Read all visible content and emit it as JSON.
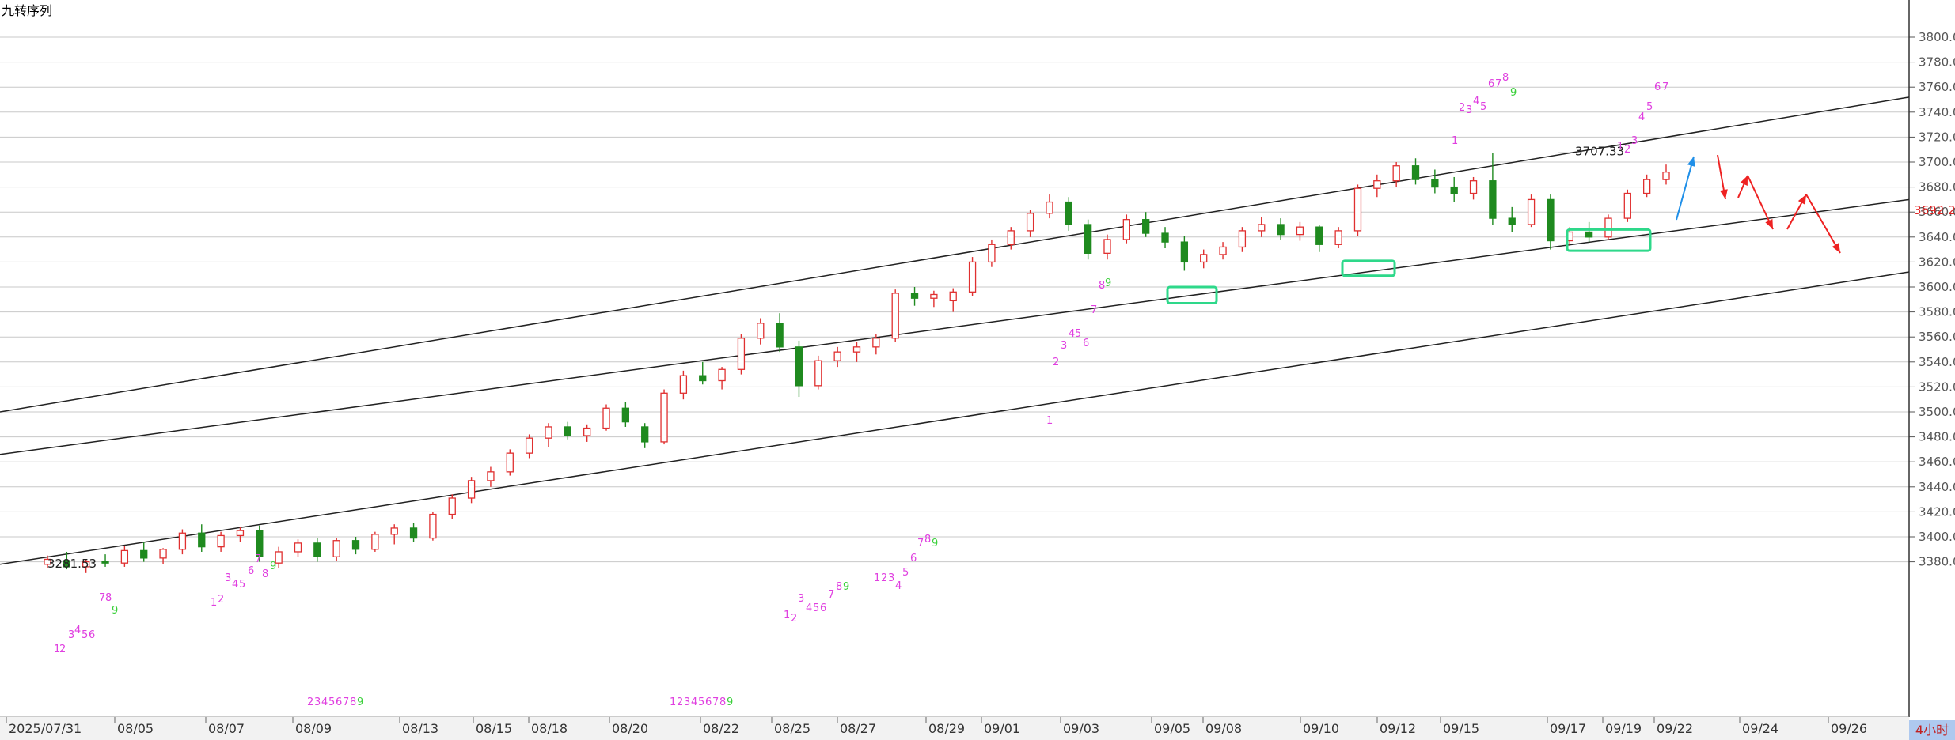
{
  "title": "九转序列",
  "interval": "4小时",
  "current_price": "3692.25",
  "colors": {
    "up": "#e03030",
    "down": "#1f8a1f",
    "sequence": "#e040e0",
    "sequence_complete": "#3ad03a",
    "highlight_box": "#2ed88a",
    "arrow_up": "#1f8fe8",
    "arrow_down": "#ee2222"
  },
  "chart_data": {
    "type": "candlestick",
    "title": "九转序列",
    "xlabel": "",
    "ylabel": "",
    "ylim": [
      3370,
      3810
    ],
    "grid": true,
    "y_ticks": [
      3380,
      3400,
      3420,
      3440,
      3460,
      3480,
      3500,
      3520,
      3540,
      3560,
      3580,
      3600,
      3620,
      3640,
      3660,
      3680,
      3700,
      3720,
      3740,
      3760,
      3780,
      3800
    ],
    "x_ticks": [
      "2025/07/31",
      "08/05",
      "08/07",
      "08/09",
      "08/13",
      "08/15",
      "08/18",
      "08/20",
      "08/22",
      "08/25",
      "08/27",
      "08/29",
      "09/01",
      "09/03",
      "09/05",
      "09/08",
      "09/10",
      "09/12",
      "09/15",
      "09/17",
      "09/19",
      "09/22",
      "09/24",
      "09/26"
    ],
    "annotations": [
      {
        "text": "3281.53",
        "x": "07/31",
        "y": 3378
      },
      {
        "text": "3707.33",
        "x": "09/17",
        "y": 3707.33
      }
    ],
    "ohlc": [
      [
        3378,
        3385,
        3375,
        3382
      ],
      [
        3381,
        3388,
        3374,
        3376
      ],
      [
        3376,
        3382,
        3371,
        3380
      ],
      [
        3380,
        3386,
        3376,
        3379
      ],
      [
        3379,
        3393,
        3376,
        3389
      ],
      [
        3389,
        3396,
        3380,
        3383
      ],
      [
        3383,
        3391,
        3378,
        3390
      ],
      [
        3390,
        3406,
        3386,
        3403
      ],
      [
        3403,
        3410,
        3388,
        3392
      ],
      [
        3392,
        3404,
        3388,
        3401
      ],
      [
        3401,
        3408,
        3396,
        3405
      ],
      [
        3405,
        3409,
        3380,
        3384
      ],
      [
        3379,
        3392,
        3375,
        3388
      ],
      [
        3388,
        3398,
        3384,
        3395
      ],
      [
        3395,
        3399,
        3380,
        3384
      ],
      [
        3384,
        3399,
        3381,
        3397
      ],
      [
        3397,
        3400,
        3386,
        3390
      ],
      [
        3390,
        3404,
        3388,
        3402
      ],
      [
        3402,
        3410,
        3394,
        3407
      ],
      [
        3407,
        3411,
        3396,
        3399
      ],
      [
        3399,
        3420,
        3397,
        3418
      ],
      [
        3418,
        3434,
        3414,
        3431
      ],
      [
        3431,
        3448,
        3427,
        3445
      ],
      [
        3445,
        3456,
        3440,
        3452
      ],
      [
        3452,
        3470,
        3449,
        3467
      ],
      [
        3467,
        3482,
        3463,
        3479
      ],
      [
        3479,
        3491,
        3472,
        3488
      ],
      [
        3488,
        3492,
        3478,
        3481
      ],
      [
        3481,
        3490,
        3476,
        3487
      ],
      [
        3487,
        3506,
        3485,
        3503
      ],
      [
        3503,
        3508,
        3488,
        3492
      ],
      [
        3488,
        3491,
        3471,
        3476
      ],
      [
        3476,
        3518,
        3474,
        3515
      ],
      [
        3515,
        3533,
        3510,
        3529
      ],
      [
        3529,
        3540,
        3522,
        3525
      ],
      [
        3525,
        3536,
        3518,
        3534
      ],
      [
        3534,
        3562,
        3530,
        3559
      ],
      [
        3559,
        3575,
        3554,
        3571
      ],
      [
        3571,
        3579,
        3548,
        3552
      ],
      [
        3552,
        3557,
        3512,
        3521
      ],
      [
        3521,
        3545,
        3518,
        3541
      ],
      [
        3541,
        3552,
        3536,
        3548
      ],
      [
        3548,
        3556,
        3540,
        3552
      ],
      [
        3552,
        3562,
        3546,
        3559
      ],
      [
        3559,
        3598,
        3556,
        3595
      ],
      [
        3595,
        3600,
        3585,
        3591
      ],
      [
        3591,
        3597,
        3584,
        3594
      ],
      [
        3589,
        3599,
        3580,
        3596
      ],
      [
        3596,
        3624,
        3593,
        3620
      ],
      [
        3620,
        3638,
        3616,
        3634
      ],
      [
        3634,
        3648,
        3630,
        3645
      ],
      [
        3645,
        3662,
        3640,
        3659
      ],
      [
        3659,
        3674,
        3655,
        3668
      ],
      [
        3668,
        3672,
        3645,
        3650
      ],
      [
        3650,
        3654,
        3622,
        3627
      ],
      [
        3627,
        3642,
        3622,
        3638
      ],
      [
        3638,
        3658,
        3635,
        3654
      ],
      [
        3654,
        3660,
        3640,
        3643
      ],
      [
        3643,
        3648,
        3631,
        3636
      ],
      [
        3636,
        3641,
        3613,
        3620
      ],
      [
        3620,
        3630,
        3615,
        3626
      ],
      [
        3626,
        3636,
        3622,
        3632
      ],
      [
        3632,
        3648,
        3628,
        3645
      ],
      [
        3645,
        3656,
        3640,
        3650
      ],
      [
        3650,
        3655,
        3638,
        3642
      ],
      [
        3642,
        3652,
        3637,
        3648
      ],
      [
        3648,
        3650,
        3628,
        3634
      ],
      [
        3634,
        3648,
        3631,
        3645
      ],
      [
        3645,
        3682,
        3641,
        3679
      ],
      [
        3679,
        3690,
        3672,
        3685
      ],
      [
        3685,
        3700,
        3680,
        3697
      ],
      [
        3697,
        3703,
        3682,
        3686
      ],
      [
        3686,
        3694,
        3675,
        3680
      ],
      [
        3680,
        3688,
        3668,
        3675
      ],
      [
        3675,
        3688,
        3670,
        3685
      ],
      [
        3685,
        3707,
        3650,
        3655
      ],
      [
        3655,
        3664,
        3644,
        3650
      ],
      [
        3650,
        3674,
        3648,
        3670
      ],
      [
        3670,
        3674,
        3630,
        3637
      ],
      [
        3637,
        3648,
        3633,
        3644
      ],
      [
        3644,
        3652,
        3636,
        3640
      ],
      [
        3640,
        3658,
        3638,
        3655
      ],
      [
        3655,
        3678,
        3652,
        3675
      ],
      [
        3675,
        3690,
        3672,
        3686
      ],
      [
        3686,
        3698,
        3682,
        3692
      ]
    ],
    "channel_lines": [
      {
        "from": [
          "07/31",
          3500
        ],
        "to": [
          "09/22+",
          3752
        ]
      },
      {
        "from": [
          "07/31",
          3466
        ],
        "to": [
          "09/22+",
          3670
        ]
      },
      {
        "from": [
          "07/31",
          3378
        ],
        "to": [
          "09/22+",
          3612
        ]
      }
    ],
    "highlight_boxes": [
      {
        "label": "09/05",
        "y_range": [
          3587,
          3600
        ]
      },
      {
        "label": "09/11",
        "y_range": [
          3609,
          3621
        ]
      },
      {
        "label": "09/18",
        "y_range": [
          3629,
          3646
        ]
      }
    ]
  },
  "sequences": [
    {
      "x": 68,
      "y": 825,
      "text": "1",
      "kind": "pink"
    },
    {
      "x": 75,
      "y": 825,
      "text": "2",
      "kind": "pink"
    },
    {
      "x": 86,
      "y": 807,
      "text": "3",
      "kind": "pink"
    },
    {
      "x": 94,
      "y": 801,
      "text": "4",
      "kind": "pink"
    },
    {
      "x": 103,
      "y": 807,
      "text": "5",
      "kind": "pink"
    },
    {
      "x": 112,
      "y": 807,
      "text": "6",
      "kind": "pink"
    },
    {
      "x": 125,
      "y": 760,
      "text": "7",
      "kind": "pink"
    },
    {
      "x": 133,
      "y": 760,
      "text": "8",
      "kind": "pink"
    },
    {
      "x": 141,
      "y": 776,
      "text": "9",
      "kind": "green"
    },
    {
      "x": 266,
      "y": 766,
      "text": "1",
      "kind": "pink"
    },
    {
      "x": 275,
      "y": 762,
      "text": "2",
      "kind": "pink"
    },
    {
      "x": 284,
      "y": 735,
      "text": "3",
      "kind": "pink"
    },
    {
      "x": 293,
      "y": 743,
      "text": "4",
      "kind": "pink"
    },
    {
      "x": 302,
      "y": 743,
      "text": "5",
      "kind": "pink"
    },
    {
      "x": 313,
      "y": 726,
      "text": "6",
      "kind": "pink"
    },
    {
      "x": 322,
      "y": 711,
      "text": "7",
      "kind": "pink"
    },
    {
      "x": 331,
      "y": 730,
      "text": "8",
      "kind": "pink"
    },
    {
      "x": 341,
      "y": 720,
      "text": "9",
      "kind": "green"
    },
    {
      "x": 388,
      "y": 892,
      "text": "2",
      "kind": "pink"
    },
    {
      "x": 397,
      "y": 892,
      "text": "3",
      "kind": "pink"
    },
    {
      "x": 406,
      "y": 892,
      "text": "4",
      "kind": "pink"
    },
    {
      "x": 415,
      "y": 892,
      "text": "5",
      "kind": "pink"
    },
    {
      "x": 424,
      "y": 892,
      "text": "6",
      "kind": "pink"
    },
    {
      "x": 433,
      "y": 892,
      "text": "7",
      "kind": "pink"
    },
    {
      "x": 442,
      "y": 892,
      "text": "8",
      "kind": "pink"
    },
    {
      "x": 451,
      "y": 892,
      "text": "9",
      "kind": "green"
    },
    {
      "x": 846,
      "y": 892,
      "text": "1",
      "kind": "pink"
    },
    {
      "x": 855,
      "y": 892,
      "text": "2",
      "kind": "pink"
    },
    {
      "x": 864,
      "y": 892,
      "text": "3",
      "kind": "pink"
    },
    {
      "x": 873,
      "y": 892,
      "text": "4",
      "kind": "pink"
    },
    {
      "x": 882,
      "y": 892,
      "text": "5",
      "kind": "pink"
    },
    {
      "x": 891,
      "y": 892,
      "text": "6",
      "kind": "pink"
    },
    {
      "x": 900,
      "y": 892,
      "text": "7",
      "kind": "pink"
    },
    {
      "x": 909,
      "y": 892,
      "text": "8",
      "kind": "pink"
    },
    {
      "x": 918,
      "y": 892,
      "text": "9",
      "kind": "green"
    },
    {
      "x": 990,
      "y": 782,
      "text": "1",
      "kind": "pink"
    },
    {
      "x": 999,
      "y": 786,
      "text": "2",
      "kind": "pink"
    },
    {
      "x": 1008,
      "y": 761,
      "text": "3",
      "kind": "pink"
    },
    {
      "x": 1018,
      "y": 773,
      "text": "4",
      "kind": "pink"
    },
    {
      "x": 1027,
      "y": 773,
      "text": "5",
      "kind": "pink"
    },
    {
      "x": 1036,
      "y": 773,
      "text": "6",
      "kind": "pink"
    },
    {
      "x": 1046,
      "y": 756,
      "text": "7",
      "kind": "pink"
    },
    {
      "x": 1056,
      "y": 746,
      "text": "8",
      "kind": "pink"
    },
    {
      "x": 1065,
      "y": 746,
      "text": "9",
      "kind": "green"
    },
    {
      "x": 1104,
      "y": 735,
      "text": "1",
      "kind": "pink"
    },
    {
      "x": 1113,
      "y": 735,
      "text": "2",
      "kind": "pink"
    },
    {
      "x": 1122,
      "y": 735,
      "text": "3",
      "kind": "pink"
    },
    {
      "x": 1131,
      "y": 745,
      "text": "4",
      "kind": "pink"
    },
    {
      "x": 1140,
      "y": 728,
      "text": "5",
      "kind": "pink"
    },
    {
      "x": 1150,
      "y": 710,
      "text": "6",
      "kind": "pink"
    },
    {
      "x": 1159,
      "y": 691,
      "text": "7",
      "kind": "pink"
    },
    {
      "x": 1168,
      "y": 686,
      "text": "8",
      "kind": "pink"
    },
    {
      "x": 1177,
      "y": 691,
      "text": "9",
      "kind": "green"
    },
    {
      "x": 1322,
      "y": 536,
      "text": "1",
      "kind": "pink"
    },
    {
      "x": 1330,
      "y": 462,
      "text": "2",
      "kind": "pink"
    },
    {
      "x": 1340,
      "y": 441,
      "text": "3",
      "kind": "pink"
    },
    {
      "x": 1350,
      "y": 426,
      "text": "4",
      "kind": "pink"
    },
    {
      "x": 1358,
      "y": 426,
      "text": "5",
      "kind": "pink"
    },
    {
      "x": 1368,
      "y": 438,
      "text": "6",
      "kind": "pink"
    },
    {
      "x": 1378,
      "y": 396,
      "text": "7",
      "kind": "pink"
    },
    {
      "x": 1388,
      "y": 365,
      "text": "8",
      "kind": "pink"
    },
    {
      "x": 1396,
      "y": 362,
      "text": "9",
      "kind": "green"
    },
    {
      "x": 1834,
      "y": 182,
      "text": "1",
      "kind": "pink"
    },
    {
      "x": 1843,
      "y": 140,
      "text": "2",
      "kind": "pink"
    },
    {
      "x": 1852,
      "y": 143,
      "text": "3",
      "kind": "pink"
    },
    {
      "x": 1861,
      "y": 132,
      "text": "4",
      "kind": "pink"
    },
    {
      "x": 1870,
      "y": 139,
      "text": "5",
      "kind": "pink"
    },
    {
      "x": 1880,
      "y": 110,
      "text": "6",
      "kind": "pink"
    },
    {
      "x": 1889,
      "y": 110,
      "text": "7",
      "kind": "pink"
    },
    {
      "x": 1898,
      "y": 102,
      "text": "8",
      "kind": "pink"
    },
    {
      "x": 1908,
      "y": 121,
      "text": "9",
      "kind": "green"
    },
    {
      "x": 2043,
      "y": 189,
      "text": "1",
      "kind": "pink"
    },
    {
      "x": 2052,
      "y": 193,
      "text": "2",
      "kind": "pink"
    },
    {
      "x": 2061,
      "y": 182,
      "text": "3",
      "kind": "pink"
    },
    {
      "x": 2070,
      "y": 152,
      "text": "4",
      "kind": "pink"
    },
    {
      "x": 2080,
      "y": 139,
      "text": "5",
      "kind": "pink"
    },
    {
      "x": 2090,
      "y": 114,
      "text": "6",
      "kind": "pink"
    },
    {
      "x": 2100,
      "y": 114,
      "text": "7",
      "kind": "pink"
    }
  ]
}
